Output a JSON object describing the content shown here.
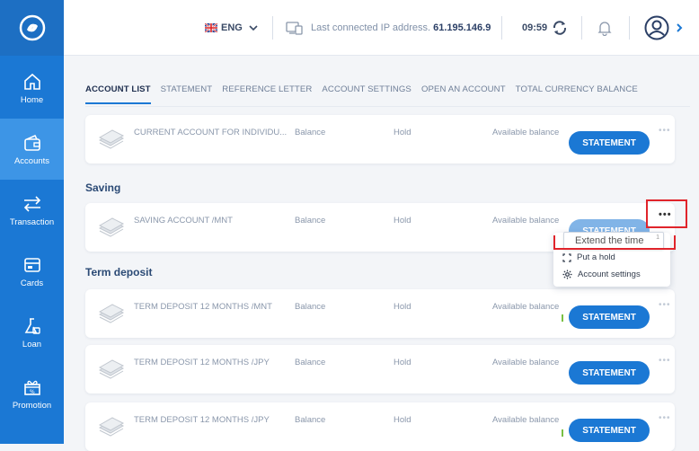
{
  "colors": {
    "brand": "#1b78d4",
    "sidebar_active": "#3d95e6",
    "highlight": "#e0242b"
  },
  "sidebar": {
    "logo_icon": "bank-logo-icon",
    "items": [
      {
        "label": "Home",
        "icon": "home-icon"
      },
      {
        "label": "Accounts",
        "icon": "wallet-icon"
      },
      {
        "label": "Transaction",
        "icon": "transfer-arrows-icon"
      },
      {
        "label": "Cards",
        "icon": "card-icon"
      },
      {
        "label": "Loan",
        "icon": "flask-icon"
      },
      {
        "label": "Promotion",
        "icon": "gift-icon"
      }
    ]
  },
  "topbar": {
    "language": "ENG",
    "ip_label": "Last connected IP address.",
    "ip_value": "61.195.146.9",
    "time": "09:59"
  },
  "tabs": [
    "ACCOUNT LIST",
    "STATEMENT",
    "REFERENCE LETTER",
    "ACCOUNT SETTINGS",
    "OPEN AN ACCOUNT",
    "TOTAL CURRENCY BALANCE"
  ],
  "sections": {
    "saving": "Saving",
    "term_deposit": "Term deposit"
  },
  "columns": {
    "balance": "Balance",
    "hold": "Hold",
    "available": "Available balance"
  },
  "statement_button": "STATEMENT",
  "accounts": [
    {
      "name": "CURRENT ACCOUNT FOR INDIVIDU..."
    },
    {
      "name": "SAVING ACCOUNT /MNT"
    },
    {
      "name": "TERM DEPOSIT 12 MONTHS /MNT"
    },
    {
      "name": "TERM DEPOSIT 12 MONTHS /JPY"
    },
    {
      "name": "TERM DEPOSIT 12 MONTHS /JPY"
    }
  ],
  "more_menu": {
    "tooltip": "Extend the time",
    "tooltip_badge": "1",
    "items": [
      "Put a hold",
      "Account settings"
    ]
  }
}
